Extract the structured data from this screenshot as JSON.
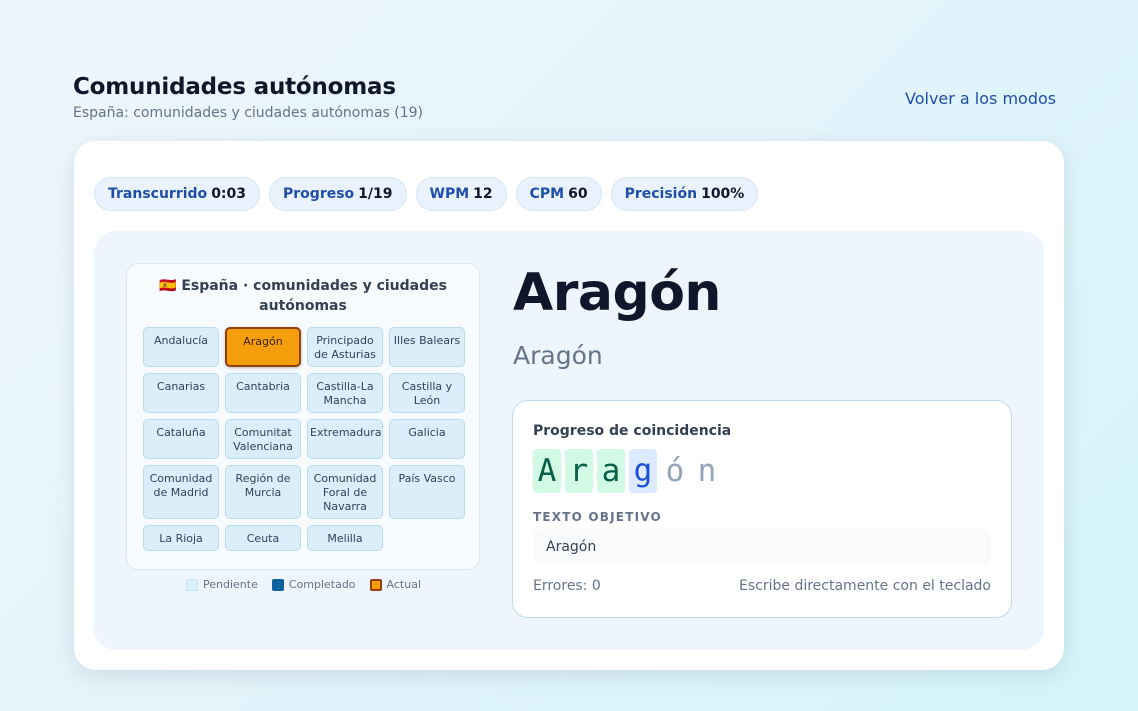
{
  "header": {
    "title": "Comunidades autónomas",
    "subtitle": "España: comunidades y ciudades autónomas (19)",
    "back_label": "Volver a los modos"
  },
  "stats": [
    {
      "label": "Transcurrido",
      "value": "0:03"
    },
    {
      "label": "Progreso",
      "value": "1/19"
    },
    {
      "label": "WPM",
      "value": "12"
    },
    {
      "label": "CPM",
      "value": "60"
    },
    {
      "label": "Precisión",
      "value": "100%"
    }
  ],
  "map": {
    "flag_icon": "spain-flag-icon",
    "flag_glyph": "🇪🇸",
    "title": "España · comunidades y ciudades autónomas",
    "tiles": [
      {
        "label": "Andalucía",
        "state": "pending"
      },
      {
        "label": "Aragón",
        "state": "current"
      },
      {
        "label": "Principado de Asturias",
        "state": "pending"
      },
      {
        "label": "Illes Balears",
        "state": "pending"
      },
      {
        "label": "Canarias",
        "state": "pending"
      },
      {
        "label": "Cantabria",
        "state": "pending"
      },
      {
        "label": "Castilla-La Mancha",
        "state": "pending"
      },
      {
        "label": "Castilla y León",
        "state": "pending"
      },
      {
        "label": "Cataluña",
        "state": "pending"
      },
      {
        "label": "Comunitat Valenciana",
        "state": "pending"
      },
      {
        "label": "Extremadura",
        "state": "pending"
      },
      {
        "label": "Galicia",
        "state": "pending"
      },
      {
        "label": "Comunidad de Madrid",
        "state": "pending"
      },
      {
        "label": "Región de Murcia",
        "state": "pending"
      },
      {
        "label": "Comunidad Foral de Navarra",
        "state": "pending"
      },
      {
        "label": "País Vasco",
        "state": "pending"
      },
      {
        "label": "La Rioja",
        "state": "pending"
      },
      {
        "label": "Ceuta",
        "state": "pending"
      },
      {
        "label": "Melilla",
        "state": "pending"
      }
    ],
    "legend": {
      "pending": "Pendiente",
      "done": "Completado",
      "current": "Actual"
    }
  },
  "target": {
    "name": "Aragón",
    "native": "Aragón"
  },
  "match": {
    "title": "Progreso de coincidencia",
    "chars": [
      {
        "char": "A",
        "state": "ok"
      },
      {
        "char": "r",
        "state": "ok"
      },
      {
        "char": "a",
        "state": "ok"
      },
      {
        "char": "g",
        "state": "cur"
      },
      {
        "char": "ó",
        "state": "pend"
      },
      {
        "char": "n",
        "state": "pend"
      }
    ],
    "target_label": "TEXTO OBJETIVO",
    "target_text": "Aragón",
    "errors": "Errores: 0",
    "hint": "Escribe directamente con el teclado"
  },
  "colors": {
    "accent": "#1e4fa8",
    "tile_pending": "#dbeffa",
    "tile_done": "#0e639c",
    "tile_current": "#f59e0b",
    "char_ok_bg": "#d1fae5",
    "char_current_bg": "#dbeafe"
  }
}
